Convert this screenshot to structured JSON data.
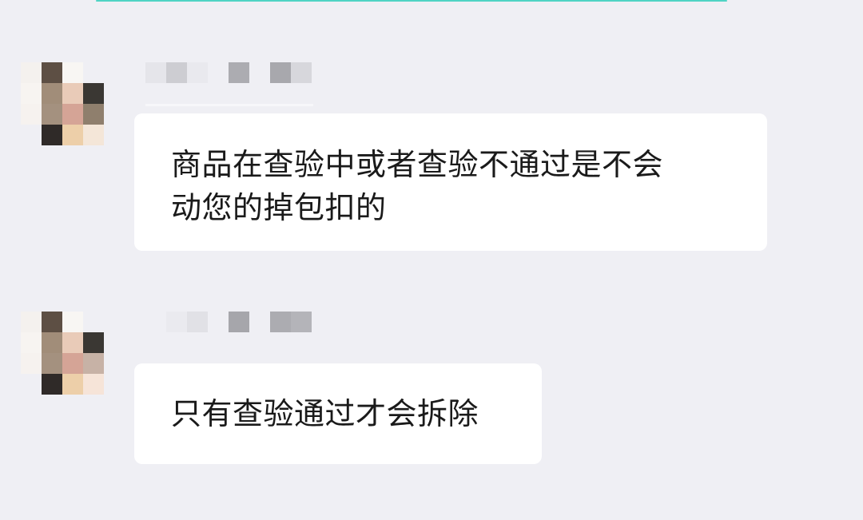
{
  "messages": [
    {
      "text": "商品在查验中或者查验不通过是不会",
      "text_line2": "动您的掉包扣的"
    },
    {
      "text": "只有查验通过才会拆除"
    }
  ]
}
